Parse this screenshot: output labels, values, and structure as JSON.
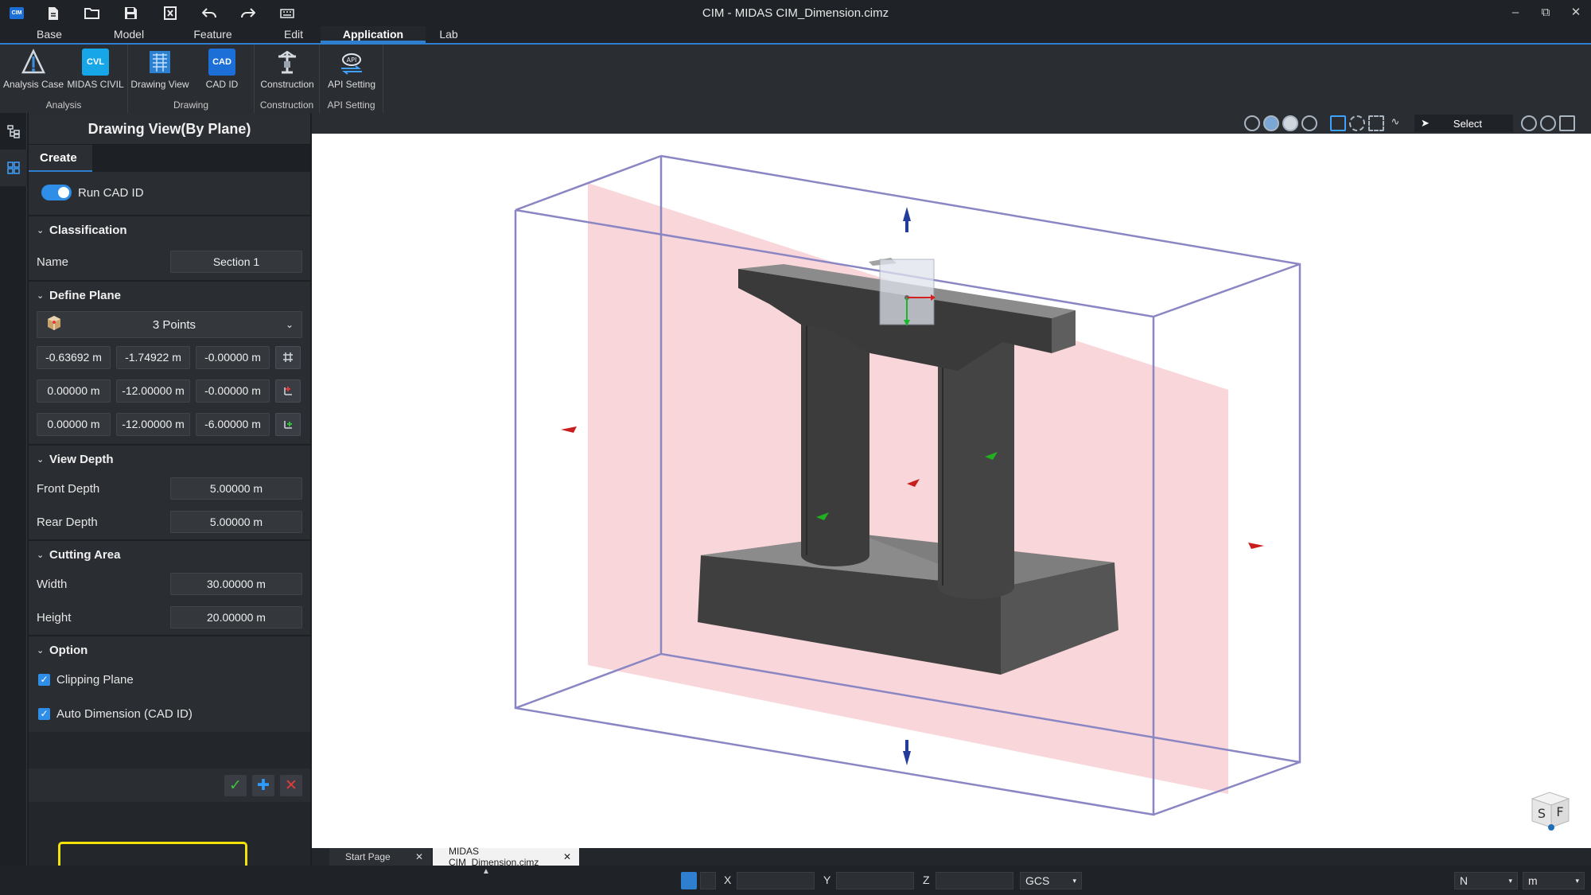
{
  "window": {
    "title": "CIM - MIDAS CIM_Dimension.cimz",
    "app_logo": "CIM",
    "controls": [
      "minimize-icon",
      "restore-icon",
      "close-icon"
    ]
  },
  "quick_access": [
    "new-file-icon",
    "open-folder-icon",
    "save-icon",
    "close-file-icon",
    "undo-icon",
    "redo-icon",
    "keyboard-icon"
  ],
  "menu": {
    "tabs": [
      "Base",
      "Model",
      "Feature",
      "Edit",
      "Application",
      "Lab"
    ],
    "active": "Application"
  },
  "ribbon": {
    "groups": [
      {
        "label": "Analysis",
        "buttons": [
          {
            "label": "Analysis Case",
            "icon": "analysis-case-icon"
          },
          {
            "label": "MIDAS CIVIL",
            "icon": "midas-civil-icon",
            "tile": "CVL"
          }
        ]
      },
      {
        "label": "Drawing",
        "buttons": [
          {
            "label": "Drawing View",
            "icon": "drawing-view-icon"
          },
          {
            "label": "CAD ID",
            "icon": "cad-id-icon",
            "tile": "CAD"
          }
        ]
      },
      {
        "label": "Construction",
        "buttons": [
          {
            "label": "Construction",
            "icon": "construction-icon"
          }
        ]
      },
      {
        "label": "API Setting",
        "buttons": [
          {
            "label": "API Setting",
            "icon": "api-setting-icon",
            "tile": "API"
          }
        ]
      }
    ]
  },
  "panel": {
    "title": "Drawing View(By Plane)",
    "tab": "Create",
    "run_cad_id": {
      "label": "Run CAD ID",
      "on": true
    },
    "classification": {
      "heading": "Classification",
      "name_label": "Name",
      "name_value": "Section 1"
    },
    "define_plane": {
      "heading": "Define Plane",
      "method": "3 Points",
      "points": [
        [
          "-0.63692 m",
          "-1.74922 m",
          "-0.00000 m"
        ],
        [
          "0.00000 m",
          "-12.00000 m",
          "-0.00000 m"
        ],
        [
          "0.00000 m",
          "-12.00000 m",
          "-6.00000 m"
        ]
      ]
    },
    "view_depth": {
      "heading": "View Depth",
      "front_label": "Front Depth",
      "front_value": "5.00000 m",
      "rear_label": "Rear Depth",
      "rear_value": "5.00000 m"
    },
    "cutting_area": {
      "heading": "Cutting Area",
      "width_label": "Width",
      "width_value": "30.00000 m",
      "height_label": "Height",
      "height_value": "20.00000 m"
    },
    "option": {
      "heading": "Option",
      "clipping_plane": {
        "label": "Clipping Plane",
        "checked": true
      },
      "auto_dimension": {
        "label": "Auto Dimension (CAD ID)",
        "checked": true
      }
    },
    "actions": [
      "confirm-icon",
      "add-icon",
      "cancel-icon"
    ]
  },
  "viewport_toolbar": {
    "select_label": "Select"
  },
  "view_cube": {
    "left": "S",
    "right": "F"
  },
  "doc_tabs": [
    {
      "label": "Start Page",
      "active": false
    },
    {
      "label": "MIDAS CIM_Dimension.cimz",
      "active": true
    }
  ],
  "statusbar": {
    "x_label": "X",
    "y_label": "Y",
    "z_label": "Z",
    "coord_system": "GCS",
    "force_unit": "N",
    "length_unit": "m"
  },
  "colors": {
    "accent": "#2f8fe8",
    "highlight": "#f3e20a",
    "clip_plane": "#f6c8cc",
    "bounding_box": "#8a86c4"
  }
}
